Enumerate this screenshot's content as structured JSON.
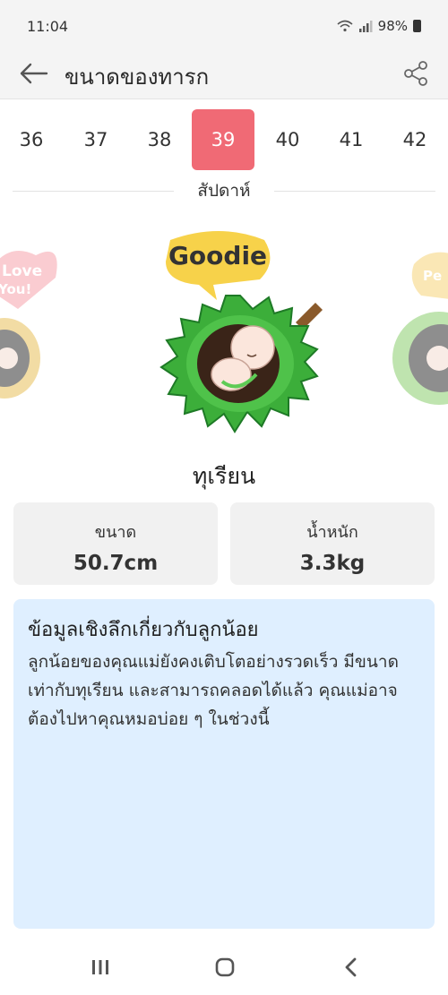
{
  "status": {
    "time": "11:04",
    "battery": "98%"
  },
  "appbar": {
    "title": "ขนาดของทารก"
  },
  "weeks": {
    "items": [
      "36",
      "37",
      "38",
      "39",
      "40",
      "41",
      "42"
    ],
    "selected": "39",
    "caption": "สัปดาห์"
  },
  "hero": {
    "bubble_text": "Goodie",
    "left_sticker_text": "Love You!",
    "right_sticker_text": "Pe"
  },
  "fruit": {
    "name": "ทุเรียน"
  },
  "stats": {
    "size_label": "ขนาด",
    "size_value": "50.7cm",
    "weight_label": "น้ำหนัก",
    "weight_value": "3.3kg"
  },
  "info": {
    "title": "ข้อมูลเชิงลึกเกี่ยวกับลูกน้อย",
    "body": "ลูกน้อยของคุณแม่ยังคงเติบโตอย่างรวดเร็ว มีขนาดเท่ากับทุเรียน และสามารถคลอดได้แล้ว คุณแม่อาจต้องไปหาคุณหมอบ่อย ๆ ในช่วงนี้"
  },
  "colors": {
    "accent": "#f06a75",
    "info_bg": "#dfefff",
    "card_bg": "#f1f1f1"
  }
}
